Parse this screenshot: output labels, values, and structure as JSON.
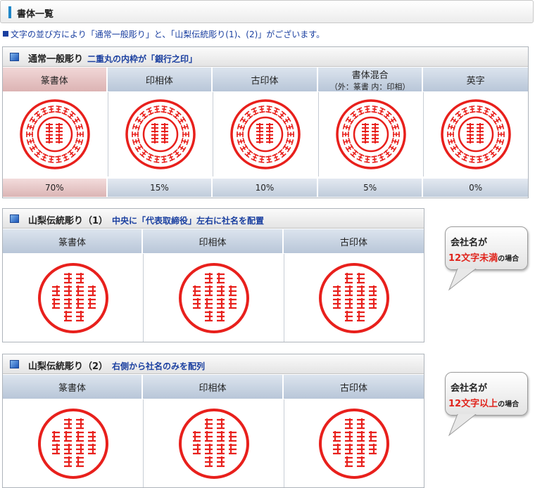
{
  "header": {
    "title": "書体一覧"
  },
  "intro": {
    "text": "文字の並び方により「通常一般彫り」と、「山梨伝統彫り(1)、(2)」がございます。"
  },
  "colors": {
    "stamp_red": "#e8201c",
    "accent_blue": "#1a3fa0",
    "header_bar": "#1f86c8"
  },
  "sections": [
    {
      "title": "通常一般彫り",
      "subtitle": "二重丸の内枠が「銀行之印」",
      "columns": [
        {
          "label": "篆書体",
          "label2": "",
          "percent": "70%"
        },
        {
          "label": "印相体",
          "label2": "",
          "percent": "15%"
        },
        {
          "label": "古印体",
          "label2": "",
          "percent": "10%"
        },
        {
          "label": "書体混合",
          "label2": "（外：篆書 内：印相）",
          "percent": "5%"
        },
        {
          "label": "英字",
          "label2": "",
          "percent": "0%"
        }
      ]
    },
    {
      "title": "山梨伝統彫り（1）",
      "subtitle": "中央に「代表取締役」左右に社名を配置",
      "columns": [
        {
          "label": "篆書体"
        },
        {
          "label": "印相体"
        },
        {
          "label": "古印体"
        }
      ]
    },
    {
      "title": "山梨伝統彫り（2）",
      "subtitle": "右側から社名のみを配列",
      "columns": [
        {
          "label": "篆書体"
        },
        {
          "label": "印相体"
        },
        {
          "label": "古印体"
        }
      ]
    }
  ],
  "callouts": [
    {
      "line1": "会社名が",
      "highlight": "12文字未満",
      "tail": "の場合"
    },
    {
      "line1": "会社名が",
      "highlight": "12文字以上",
      "tail": "の場合"
    }
  ]
}
